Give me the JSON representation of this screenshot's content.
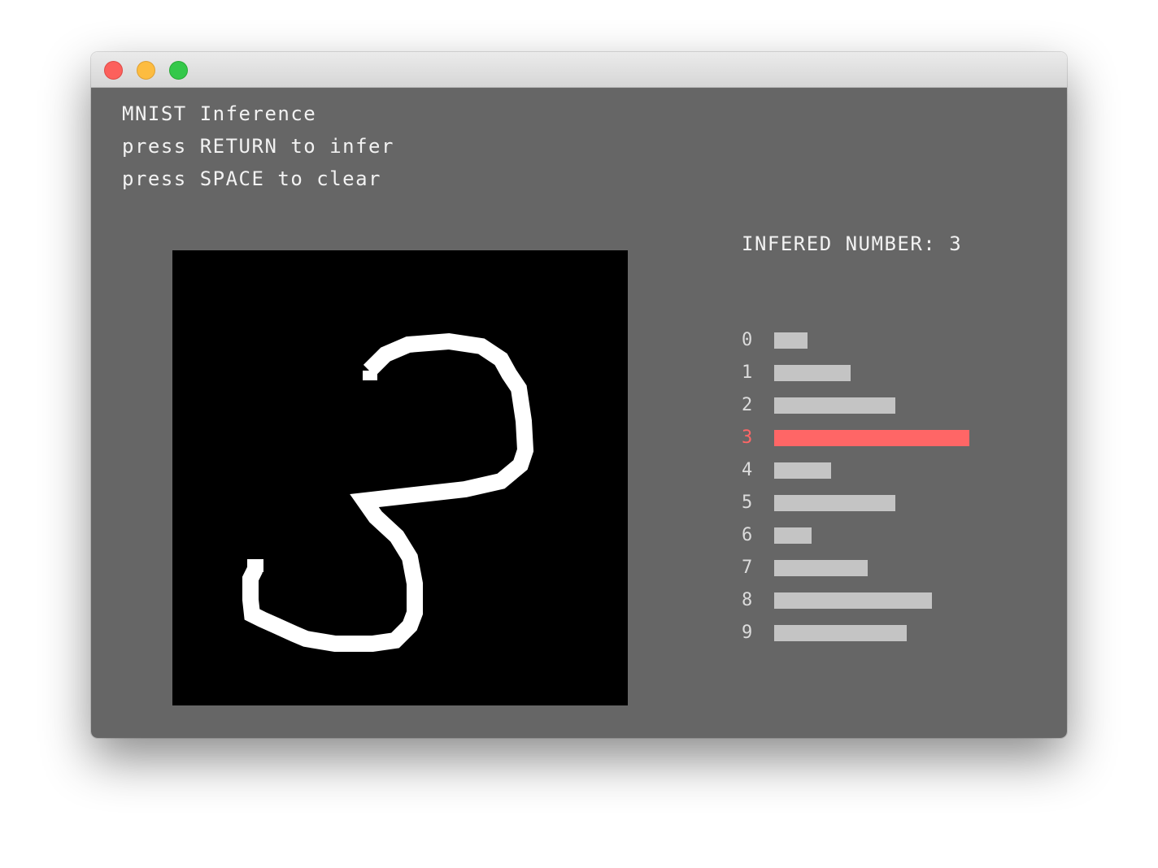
{
  "window": {
    "controls": [
      "close",
      "minimize",
      "maximize"
    ]
  },
  "app": {
    "title": "MNIST Inference",
    "hint_return": "press RETURN to infer",
    "hint_space": "press SPACE to clear",
    "result_text": "INFERED NUMBER: 3"
  },
  "canvas": {
    "content": "handwritten digit drawn in white on black"
  },
  "scores": {
    "predicted": 3,
    "highlight_color": "#ff6666",
    "bar_color": "#c4c4c4",
    "rows": [
      {
        "digit": "0",
        "value": 0.17
      },
      {
        "digit": "1",
        "value": 0.39
      },
      {
        "digit": "2",
        "value": 0.62
      },
      {
        "digit": "3",
        "value": 1.0
      },
      {
        "digit": "4",
        "value": 0.29
      },
      {
        "digit": "5",
        "value": 0.62
      },
      {
        "digit": "6",
        "value": 0.19
      },
      {
        "digit": "7",
        "value": 0.48
      },
      {
        "digit": "8",
        "value": 0.81
      },
      {
        "digit": "9",
        "value": 0.68
      }
    ]
  }
}
